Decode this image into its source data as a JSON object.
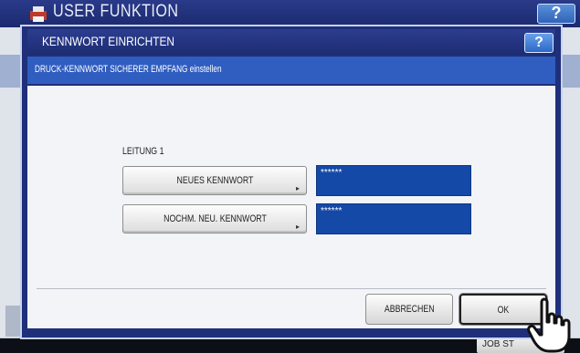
{
  "background": {
    "title": "USER FUNKTION",
    "help_label": "?",
    "job_status_label": "JOB ST"
  },
  "dialog": {
    "title": "KENNWORT EINRICHTEN",
    "help_label": "?",
    "subtitle": "DRUCK-KENNWORT SICHERER EMPFANG einstellen",
    "line_label": "LEITUNG 1",
    "fields": [
      {
        "button_label": "NEUES KENNWORT",
        "value": "******"
      },
      {
        "button_label": "NOCHM. NEU. KENNWORT",
        "value": "******"
      }
    ],
    "cancel_label": "ABBRECHEN",
    "ok_label": "OK"
  },
  "colors": {
    "title_bar": "#1d2c72",
    "subtitle_bar": "#2f5dc0",
    "value_field": "#1449a8"
  },
  "icons": [
    "printer-logo-icon",
    "help-icon",
    "hand-pointer-icon",
    "arrow-indicator-icon"
  ]
}
